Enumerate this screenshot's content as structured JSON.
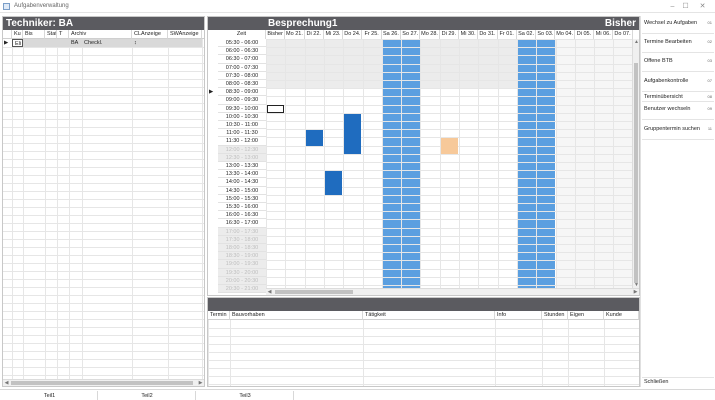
{
  "window": {
    "title": "Aufgabenverwaltung",
    "minimize_glyph": "–",
    "maximize_glyph": "☐",
    "close_glyph": "✕"
  },
  "left": {
    "header": "Techniker: BA",
    "columns": [
      "Ku",
      "Bis",
      "Stat",
      "T",
      "Archiv",
      "CLAnzeige",
      "SWAnzeige",
      "C"
    ],
    "row": {
      "marker": "▶",
      "ku": "Eli",
      "t": "BA",
      "archiv": "Checkl.",
      "cl": "↕"
    }
  },
  "calendar": {
    "header_left": "Besprechung1",
    "header_right": "Bisher",
    "time_col_label": "Zeit",
    "days": [
      "Bisher",
      "Mo 21.",
      "Di 22.",
      "Mi 23.",
      "Do 24.",
      "Fr 25.",
      "Sa 26.",
      "So 27.",
      "Mo 28.",
      "Di 29.",
      "Mi 30.",
      "Do 31.",
      "Fr 01.",
      "Sa 02.",
      "So 03.",
      "Mo 04.",
      "Di 05.",
      "Mi 06.",
      "Do 07."
    ],
    "times": [
      "05:30 - 06:00",
      "06:00 - 06:30",
      "06:30 - 07:00",
      "07:00 - 07:30",
      "07:30 - 08:00",
      "08:00 - 08:30",
      "08:30 - 09:00",
      "09:00 - 09:30",
      "09:30 - 10:00",
      "10:00 - 10:30",
      "10:30 - 11:00",
      "11:00 - 11:30",
      "11:30 - 12:00",
      "12:00 - 12:30",
      "12:30 - 13:00",
      "13:00 - 13:30",
      "13:30 - 14:00",
      "14:00 - 14:30",
      "14:30 - 15:00",
      "15:00 - 15:30",
      "15:30 - 16:00",
      "16:00 - 16:30",
      "16:30 - 17:00",
      "17:00 - 17:30",
      "17:30 - 18:00",
      "18:00 - 18:30",
      "18:30 - 19:00",
      "19:00 - 19:30",
      "19:30 - 20:00",
      "20:00 - 20:30",
      "20:30 - 21:00"
    ],
    "off_times": [
      "12:00 - 12:30",
      "12:30 - 13:00",
      "17:00 - 17:30",
      "17:30 - 18:00",
      "18:00 - 18:30",
      "18:30 - 19:00",
      "19:00 - 19:30",
      "19:30 - 20:00",
      "20:00 - 20:30",
      "20:30 - 21:00"
    ],
    "current_row_marker": "▶",
    "colors": {
      "weekend": "#5b9fe0",
      "appointment": "#1f6cbf",
      "pending": "#f7c99a",
      "header_bg": "#5b5b60"
    }
  },
  "bottom": {
    "columns": [
      "Termin",
      "Bauvorhaben",
      "Tätigkeit",
      "Info",
      "Stunden",
      "Eigen",
      "Kunde"
    ]
  },
  "actions": [
    {
      "label": "Wechsel zu Aufgaben",
      "num": "01"
    },
    {
      "label": "Termine Bearbeiten",
      "num": "02"
    },
    {
      "label": "Offene BTB",
      "num": "03"
    },
    {
      "label": "Aufgabenkontrolle",
      "num": "07"
    },
    {
      "label": "Terminübersicht",
      "num": "08"
    },
    {
      "label": "Benutzer  wechseln",
      "num": "09"
    },
    {
      "label": "Gruppentermin suchen",
      "num": "11"
    }
  ],
  "close_label": "Schließen",
  "tabs": [
    "Teil1",
    "Teil2",
    "Teil3"
  ]
}
